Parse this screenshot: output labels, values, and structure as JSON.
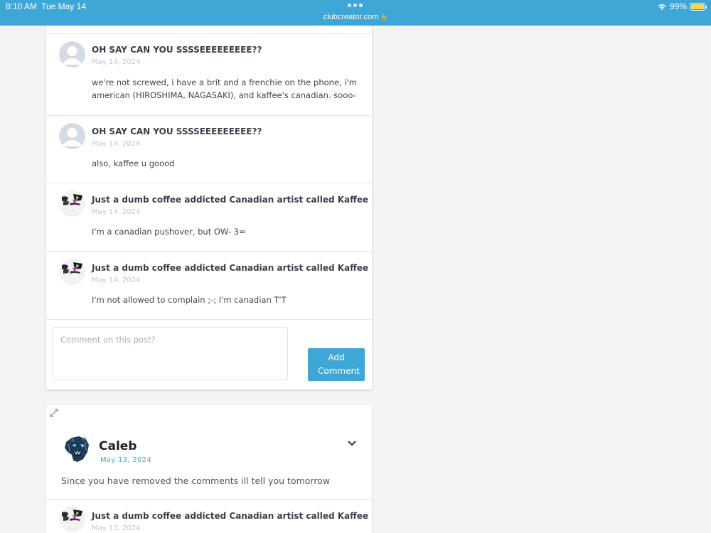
{
  "status_bar": {
    "time": "8:10 AM",
    "date": "Tue May 14",
    "url": "clubcreator.com",
    "battery": "99%",
    "battery_level": 0.99,
    "icons": [
      "wifi-icon",
      "battery-icon",
      "lock-icon"
    ]
  },
  "comments": [
    {
      "author": "OH SAY CAN YOU SSSSEEEEEEEEE??",
      "date": "May 14, 2024",
      "text": "we're not screwed, i have a brit and a frenchie on the phone, i'm american (HIROSHIMA, NAGASAKI), and kaffee's canadian. sooo-",
      "avatar": "default-avatar-icon"
    },
    {
      "author": "OH SAY CAN YOU SSSSEEEEEEEEE??",
      "date": "May 14, 2024",
      "text": "also, kaffee u goood",
      "avatar": "default-avatar-icon"
    },
    {
      "author": "Just a dumb coffee addicted Canadian artist called Kaffee",
      "date": "May 14, 2024",
      "text": "I'm a canadian pushover, but OW- 3=",
      "avatar": "kaffee-avatar"
    },
    {
      "author": "Just a dumb coffee addicted Canadian artist called Kaffee",
      "date": "May 14, 2024",
      "text": "I'm not allowed to complain ;-; I'm canadian T'T",
      "avatar": "kaffee-avatar"
    }
  ],
  "comment_form": {
    "placeholder": "Comment on this post?",
    "button_label": "Add Comment"
  },
  "post": {
    "author": "Caleb",
    "date": "May 13, 2024",
    "text": "Since you have removed the comments ill tell you tomorrow",
    "first_comment": {
      "author": "Just a dumb coffee addicted Canadian artist called Kaffee",
      "date": "May 13, 2024"
    }
  },
  "colors": {
    "accent": "#3fa7d6",
    "date_gray": "#c2c6cc",
    "author": "#3a3f4b",
    "background": "#f4f4f4"
  }
}
